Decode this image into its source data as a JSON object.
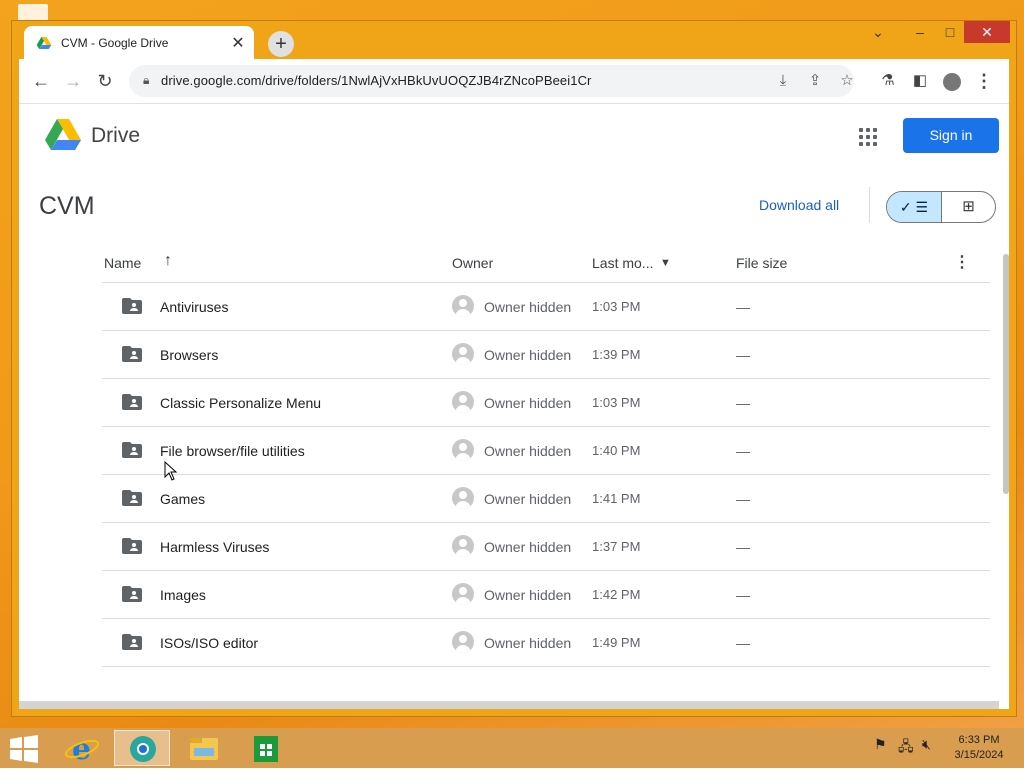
{
  "browser": {
    "tab_title": "CVM - Google Drive",
    "url": "drive.google.com/drive/folders/1NwlAjVxHBkUvUOQZJB4rZNcoPBeei1Cr"
  },
  "drive": {
    "brand": "Drive",
    "sign_in": "Sign in",
    "folder_name": "CVM",
    "download_all": "Download all",
    "columns": {
      "name": "Name",
      "owner": "Owner",
      "modified": "Last mo...",
      "size": "File size"
    },
    "rows": [
      {
        "name": "Antiviruses",
        "owner": "Owner hidden",
        "modified": "1:03 PM",
        "size": "—"
      },
      {
        "name": "Browsers",
        "owner": "Owner hidden",
        "modified": "1:39 PM",
        "size": "—"
      },
      {
        "name": "Classic Personalize Menu",
        "owner": "Owner hidden",
        "modified": "1:03 PM",
        "size": "—"
      },
      {
        "name": "File browser/file utilities",
        "owner": "Owner hidden",
        "modified": "1:40 PM",
        "size": "—"
      },
      {
        "name": "Games",
        "owner": "Owner hidden",
        "modified": "1:41 PM",
        "size": "—"
      },
      {
        "name": "Harmless Viruses",
        "owner": "Owner hidden",
        "modified": "1:37 PM",
        "size": "—"
      },
      {
        "name": "Images",
        "owner": "Owner hidden",
        "modified": "1:42 PM",
        "size": "—"
      },
      {
        "name": "ISOs/ISO editor",
        "owner": "Owner hidden",
        "modified": "1:49 PM",
        "size": "—"
      }
    ]
  },
  "taskbar": {
    "time": "6:33 PM",
    "date": "3/15/2024"
  },
  "colors": {
    "accent": "#1a73e8",
    "window_frame": "#f0a418",
    "close_button": "#c7392b"
  }
}
